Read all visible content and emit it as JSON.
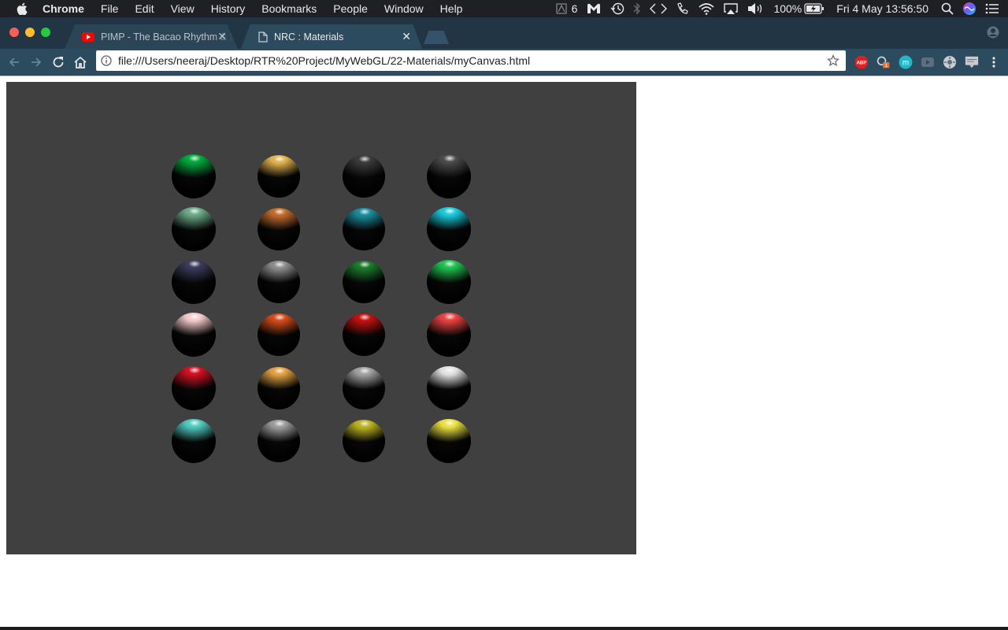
{
  "menubar": {
    "app_name": "Chrome",
    "items": [
      "File",
      "Edit",
      "View",
      "History",
      "Bookmarks",
      "People",
      "Window",
      "Help"
    ],
    "status": {
      "notification_count": "6",
      "battery": "100%",
      "datetime": "Fri 4 May  13:56:50"
    }
  },
  "tabs": [
    {
      "title": "PIMP - The Bacao Rhythm & Steel Band",
      "icon": "youtube-icon",
      "active": false
    },
    {
      "title": "NRC : Materials",
      "icon": "page-icon",
      "active": true
    }
  ],
  "toolbar": {
    "url": "file:///Users/neeraj/Desktop/RTR%20Project/MyWebGL/22-Materials/myCanvas.html",
    "extensions": [
      "adblock-icon",
      "extension-badge-icon",
      "m-extension-icon",
      "video-extension-icon",
      "settings-extension-icon",
      "screen-extension-icon",
      "chrome-menu-icon"
    ],
    "extension_badge": "1",
    "abp_label": "ABP"
  },
  "colors": {
    "menubar_bg": "#1f2023",
    "tabstrip_bg": "#213544",
    "toolbar_bg": "#2d4b5e",
    "canvas_bg": "#404040",
    "traffic_red": "#fc5f57",
    "traffic_yellow": "#fdbc2e",
    "traffic_green": "#28c840"
  },
  "materials": [
    [
      "#00a83c",
      "#e0b050",
      "#3a3a3a",
      "#4a4a4a"
    ],
    [
      "#6aa888",
      "#c06a2a",
      "#1a8a9a",
      "#18c8d8"
    ],
    [
      "#3a3a5a",
      "#8a8a8a",
      "#1a7a2a",
      "#20c050"
    ],
    [
      "#f0c8c8",
      "#d04a1a",
      "#c01010",
      "#e84040"
    ],
    [
      "#d01020",
      "#e0a040",
      "#a0a0a0",
      "#e0e0e0"
    ],
    [
      "#50c8c0",
      "#9a9a9a",
      "#b8b020",
      "#e8e040"
    ]
  ]
}
